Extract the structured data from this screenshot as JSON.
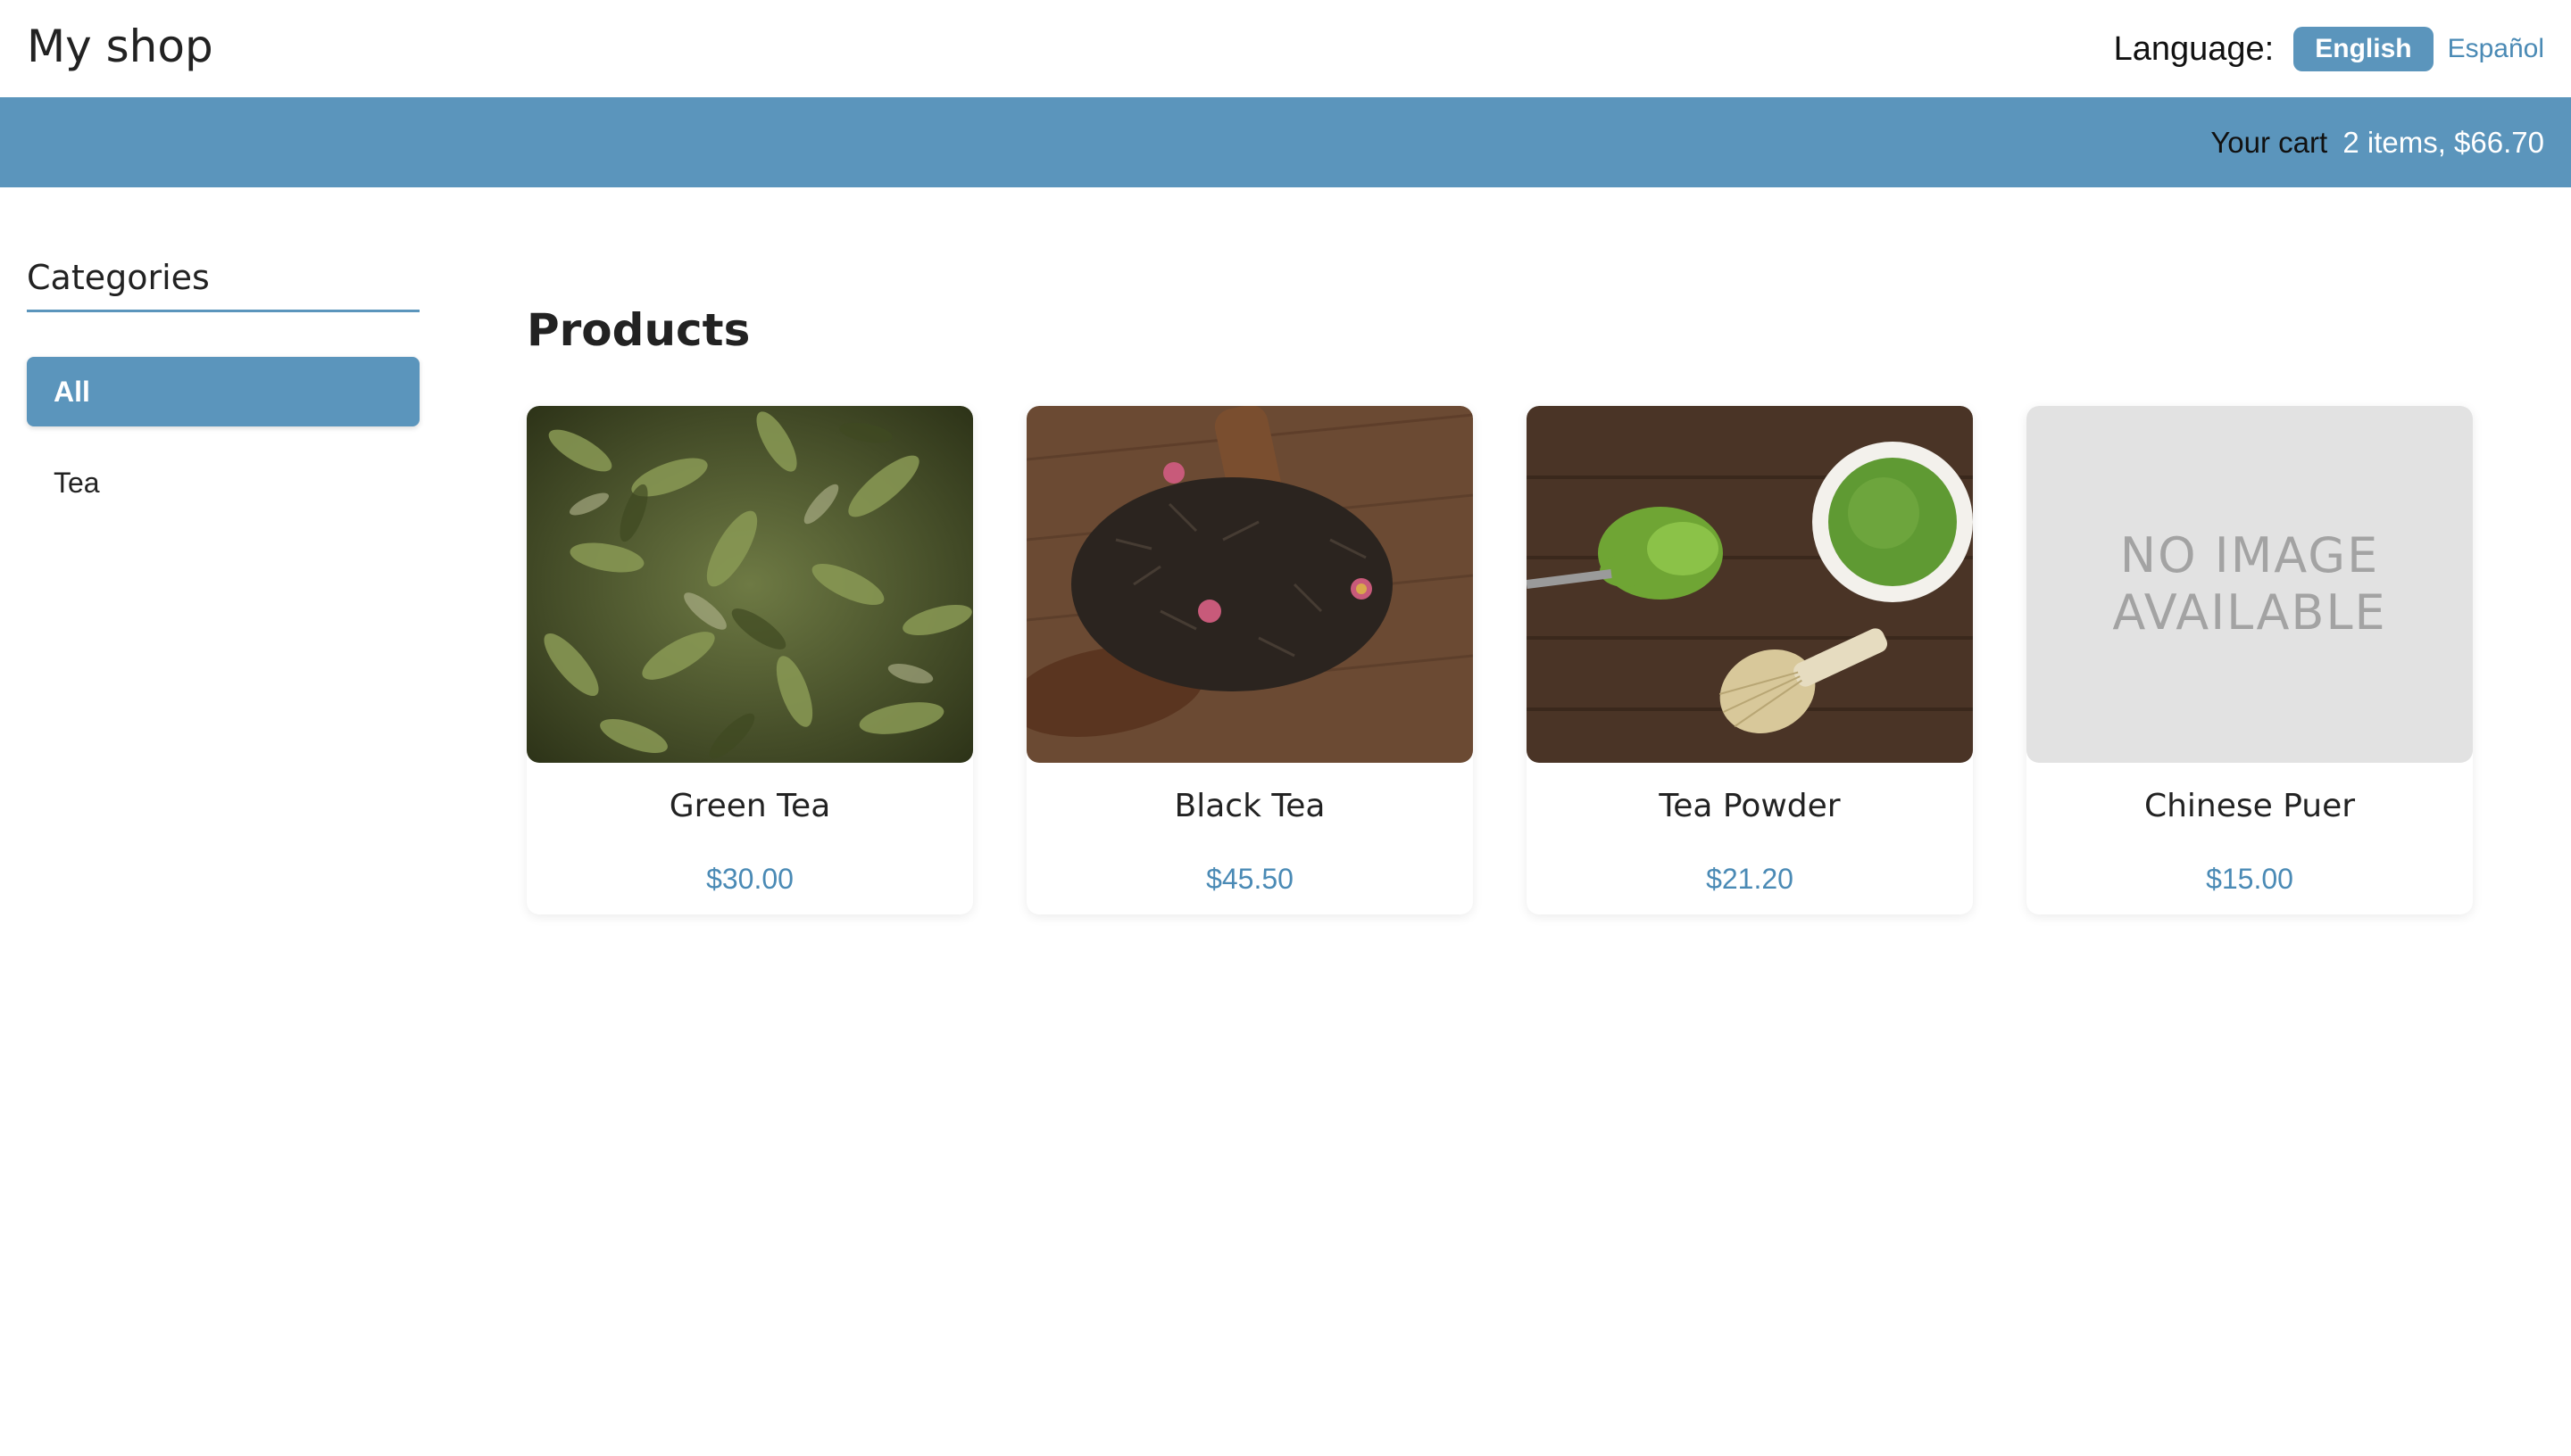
{
  "header": {
    "shop_title": "My shop",
    "language_label": "Language:",
    "languages": [
      {
        "label": "English",
        "active": true
      },
      {
        "label": "Español",
        "active": false
      }
    ]
  },
  "cart": {
    "label": "Your cart",
    "summary": "2 items, $66.70"
  },
  "sidebar": {
    "title": "Categories",
    "items": [
      {
        "label": "All",
        "active": true
      },
      {
        "label": "Tea",
        "active": false
      }
    ]
  },
  "main": {
    "title": "Products",
    "products": [
      {
        "name": "Green Tea",
        "price": "$30.00",
        "image": "green-tea-leaves"
      },
      {
        "name": "Black Tea",
        "price": "$45.50",
        "image": "black-tea-leaves"
      },
      {
        "name": "Tea Powder",
        "price": "$21.20",
        "image": "matcha-powder"
      },
      {
        "name": "Chinese Puer",
        "price": "$15.00",
        "image": "no-image",
        "no_image_line1": "NO IMAGE",
        "no_image_line2": "AVAILABLE"
      }
    ]
  },
  "colors": {
    "accent": "#5b95bc",
    "link": "#4a8ab5",
    "placeholder": "#e2e2e2"
  }
}
